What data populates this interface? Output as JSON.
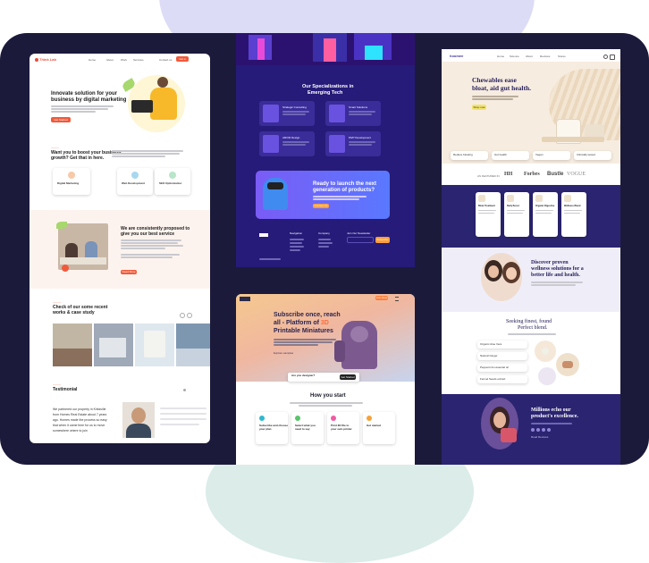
{
  "left": {
    "brand": "Think Lab",
    "nav": [
      "Home",
      "About",
      "Work",
      "Services"
    ],
    "nav_contact": "Contact us",
    "nav_cta": "Get a Quote",
    "hero_title_1": "Innovate solution for your",
    "hero_title_2": "business by digital marketing",
    "hero_button": "Get Started",
    "boost_title_1": "Want you to boost your business",
    "boost_title_2": "growth? Get that in here.",
    "service_1": "Digital Marketing",
    "service_2": "Web Development",
    "service_3": "SEO Optimization",
    "proposed_title_1": "We are consistently proposed to",
    "proposed_title_2": "give you our best service",
    "more_button": "Read More",
    "case_title_1": "Check of our some recent",
    "case_title_2": "works & case study",
    "testimonial_title": "Testimonial",
    "quote_1": "We partnered our property in Kirksville",
    "quote_2": "from Homes Real Estate about 7 years",
    "quote_3": "ago. Homes made the process so easy",
    "quote_4": "that when it came time for us to move",
    "quote_5": "somewhere where to join"
  },
  "middle_top": {
    "spec_title_1": "Our Specializations in",
    "spec_title_2": "Emerging Tech",
    "spec_1": "Strategic Consulting",
    "spec_2": "Smart Solutions",
    "spec_3": "AR/VR Design",
    "spec_4": "MVP Development",
    "cta_1": "Ready to launch the next",
    "cta_2": "generation of products?",
    "cta_button": "Contact Us",
    "footer_col_1": "Navigation",
    "footer_col_2": "Company",
    "footer_col_3": "Join Our Newsletter",
    "subscribe_button": "Subscribe"
  },
  "middle_bottom": {
    "hero_1": "Subscribe once, reach",
    "hero_2a": "all - Platform of ",
    "hero_2b": "3D",
    "hero_3": "Printable Miniatures",
    "explore_label": "Explore samples",
    "search_label": "Are you designer?",
    "search_button": "Get Started",
    "start_title": "How you start",
    "step_1a": "Subscribe and choose",
    "step_1b": "your plan",
    "step_2a": "Select what you",
    "step_2b": "need to say",
    "step_3a": "Print 3D file to",
    "step_3b": "your own printer",
    "step_4": "Get started",
    "top_cta": "Join Now"
  },
  "right": {
    "logo": "hoomee",
    "nav": [
      "Home",
      "Science",
      "About",
      "Reviews",
      "Stores"
    ],
    "hero_1": "Chewables ease",
    "hero_2": "bloat, aid gut health.",
    "hero_button": "Shop now",
    "feat_1": "Reduce bloating",
    "feat_2": "Gut health",
    "feat_3": "Vegan",
    "feat_4": "Clinically tested",
    "press_label": "AS FEATURED IN",
    "press": [
      "HH",
      "Forbes",
      "Bustle",
      "VOGUE"
    ],
    "card_1": "Bloat Treatment",
    "card_2": "Daily Boost",
    "card_3": "Organic Digestive",
    "card_4": "Wellness Blend",
    "discover_1": "Discover proven",
    "discover_2": "wellness solutions for a",
    "discover_3": "better life and health.",
    "seek_1": "Seeking finest, found",
    "seek_2": "Perfect blend.",
    "list_1": "Organic Aloe Vera",
    "list_2": "Natural Ginger",
    "list_3": "Peppermint essential oil",
    "list_4": "Fennel Seeds extract",
    "millions_1": "Millions echo our",
    "millions_2": "product's excellence.",
    "millions_label": "Read Reviews"
  }
}
